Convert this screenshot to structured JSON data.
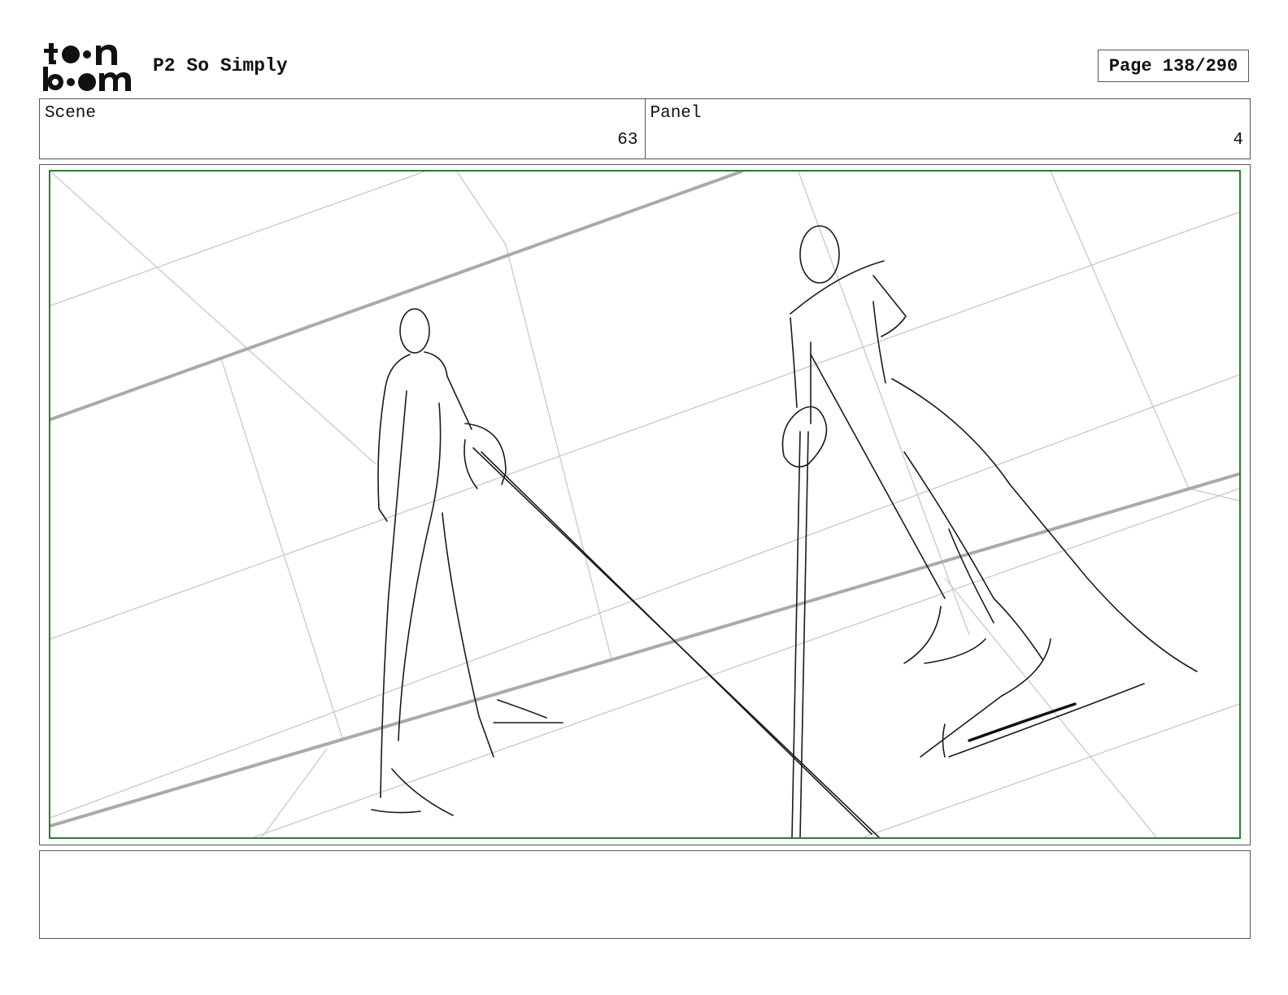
{
  "header": {
    "logo_icon": "toon-boom-logo",
    "project_title": "P2 So Simply",
    "page_label": "Page 138/290"
  },
  "info": {
    "scene_label": "Scene",
    "scene_value": "63",
    "panel_label": "Panel",
    "panel_value": "4"
  },
  "panel": {
    "frame_color": "#2e7d32",
    "description_icon": "storyboard-sketch-two-figures-with-poles"
  },
  "notes": {
    "text": ""
  }
}
